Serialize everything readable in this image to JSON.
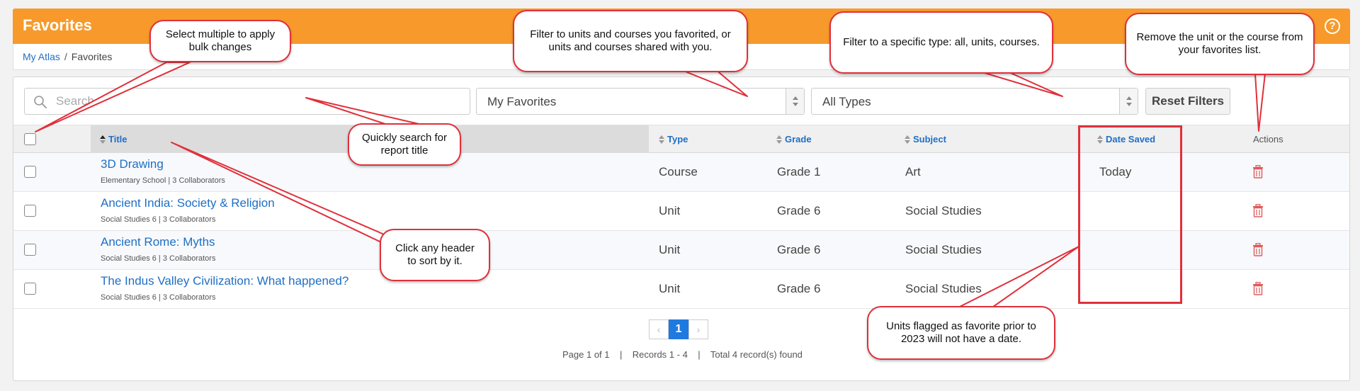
{
  "header": {
    "title": "Favorites",
    "help_icon": "question-circle-icon"
  },
  "breadcrumb": {
    "root": "My Atlas",
    "separator": "/",
    "current": "Favorites"
  },
  "filters": {
    "search_placeholder": "Search",
    "favorites_filter": "My Favorites",
    "type_filter": "All Types",
    "reset_label": "Reset Filters"
  },
  "table": {
    "columns": {
      "title": "Title",
      "type": "Type",
      "grade": "Grade",
      "subject": "Subject",
      "date_saved": "Date Saved",
      "actions": "Actions"
    },
    "rows": [
      {
        "title": "3D Drawing",
        "meta": "Elementary School | 3 Collaborators",
        "type": "Course",
        "grade": "Grade 1",
        "subject": "Art",
        "date_saved": "Today"
      },
      {
        "title": "Ancient India: Society & Religion",
        "meta": "Social Studies 6 | 3 Collaborators",
        "type": "Unit",
        "grade": "Grade 6",
        "subject": "Social Studies",
        "date_saved": ""
      },
      {
        "title": "Ancient Rome: Myths",
        "meta": "Social Studies 6 | 3 Collaborators",
        "type": "Unit",
        "grade": "Grade 6",
        "subject": "Social Studies",
        "date_saved": ""
      },
      {
        "title": "The Indus Valley Civilization: What happened?",
        "meta": "Social Studies 6 | 3 Collaborators",
        "type": "Unit",
        "grade": "Grade 6",
        "subject": "Social Studies",
        "date_saved": ""
      }
    ]
  },
  "pagination": {
    "prev": "‹",
    "current_page": "1",
    "next": "›",
    "info": "Page 1 of 1    |    Records 1 - 4    |    Total 4 record(s) found"
  },
  "callouts": {
    "bulk": "Select multiple to apply bulk changes",
    "filter_units": "Filter to units and courses you favorited, or units and courses shared with you.",
    "filter_type": "Filter to a specific type: all, units, courses.",
    "remove": "Remove the unit or the course from your favorites list.",
    "search": "Quickly search for report title",
    "sort": "Click any header to sort by it.",
    "date_note": "Units flagged as favorite prior to 2023 will not have a date."
  },
  "colors": {
    "header": "#f79a2b",
    "link": "#1f6fc5",
    "annotation": "#e0303a",
    "trash": "#e05a5a"
  }
}
